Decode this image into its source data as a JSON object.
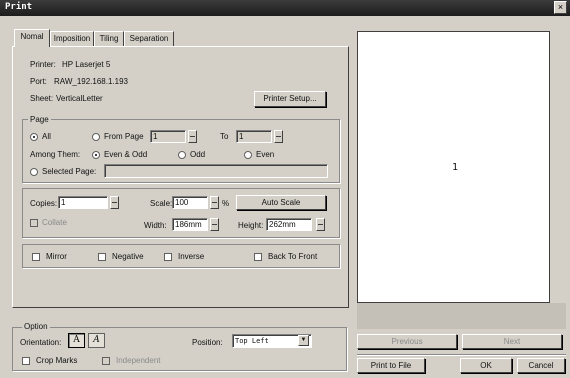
{
  "window": {
    "title": "Print",
    "close_glyph": "×"
  },
  "tabs": [
    "Nomal",
    "Imposition",
    "Tiling",
    "Separation"
  ],
  "printer_info": {
    "printer_label": "Printer:",
    "printer_value": "HP Laserjet 5",
    "port_label": "Port:",
    "port_value": "RAW_192.168.1.193",
    "sheet_label": "Sheet:",
    "sheet_value": "VerticalLetter",
    "setup_button": "Printer Setup..."
  },
  "page_group": {
    "label": "Page",
    "all": "All",
    "from_page": "From Page",
    "from_value": "1",
    "to": "To",
    "to_value": "1",
    "among_them": "Among Them:",
    "even_odd": "Even & Odd",
    "odd": "Odd",
    "even": "Even",
    "selected_page": "Selected Page:",
    "selected_value": ""
  },
  "copies_group": {
    "copies_label": "Copies:",
    "copies_value": "1",
    "collate": "Collate",
    "scale_label": "Scale:",
    "scale_value": "100",
    "percent": "%",
    "auto_scale": "Auto Scale",
    "width_label": "Width:",
    "width_value": "186mm",
    "height_label": "Height:",
    "height_value": "262mm"
  },
  "options_row": {
    "mirror": "Mirror",
    "negative": "Negative",
    "inverse": "Inverse",
    "back_to_front": "Back To Front"
  },
  "option_group": {
    "label": "Option",
    "orientation_label": "Orientation:",
    "portrait_glyph": "A",
    "landscape_glyph": "A",
    "position_label": "Position:",
    "position_value": "Top Left",
    "crop_marks": "Crop Marks",
    "independent": "Independent"
  },
  "preview": {
    "page_number": "1"
  },
  "buttons": {
    "previous": "Previous",
    "next": "Next",
    "print_to_file": "Print to File",
    "ok": "OK",
    "cancel": "Cancel"
  }
}
